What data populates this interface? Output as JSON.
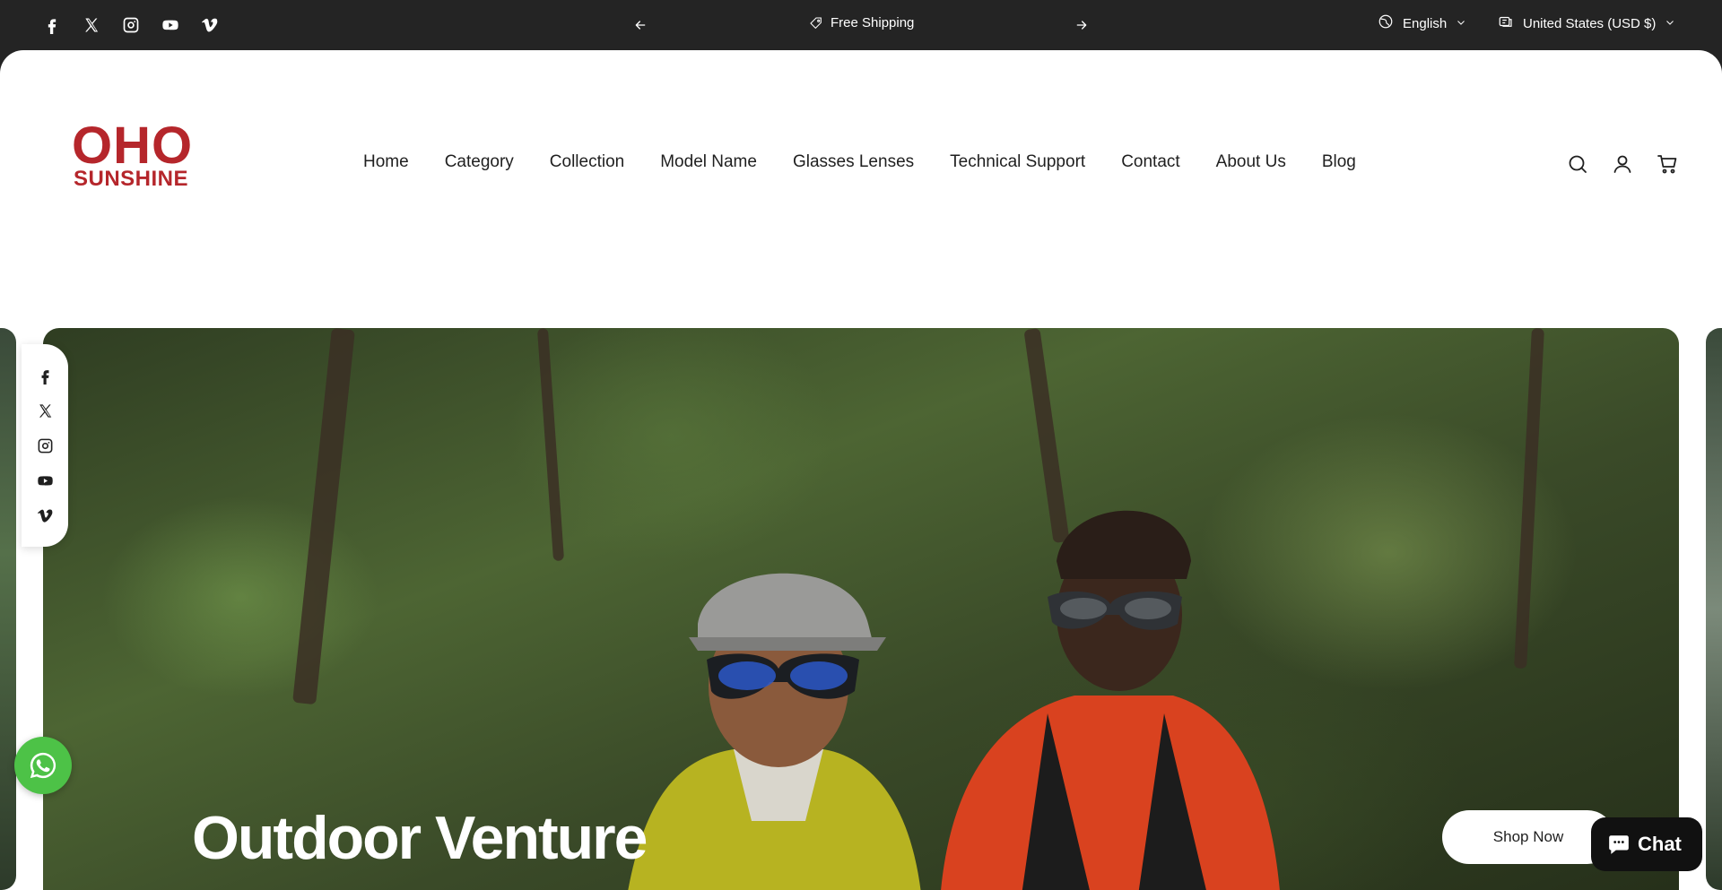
{
  "topbar": {
    "socials": [
      "facebook-icon",
      "x-icon",
      "instagram-icon",
      "youtube-icon",
      "vimeo-icon"
    ],
    "announcement": "Free Shipping",
    "language": "English",
    "country": "United States (USD $)"
  },
  "header": {
    "logo": {
      "line1": "OHO",
      "line2": "SUNSHINE"
    },
    "nav": [
      "Home",
      "Category",
      "Collection",
      "Model Name",
      "Glasses Lenses",
      "Technical Support",
      "Contact",
      "About Us",
      "Blog"
    ],
    "icons": [
      "search-icon",
      "account-icon",
      "cart-icon"
    ]
  },
  "hero": {
    "title": "Outdoor Venture",
    "button": "Shop Now"
  },
  "floating_socials": [
    "facebook-icon",
    "x-icon",
    "instagram-icon",
    "youtube-icon",
    "vimeo-icon"
  ],
  "chat": {
    "label": "Chat"
  },
  "colors": {
    "brand": "#b5262b",
    "topbar": "#242424",
    "whatsapp": "#4dc247"
  }
}
